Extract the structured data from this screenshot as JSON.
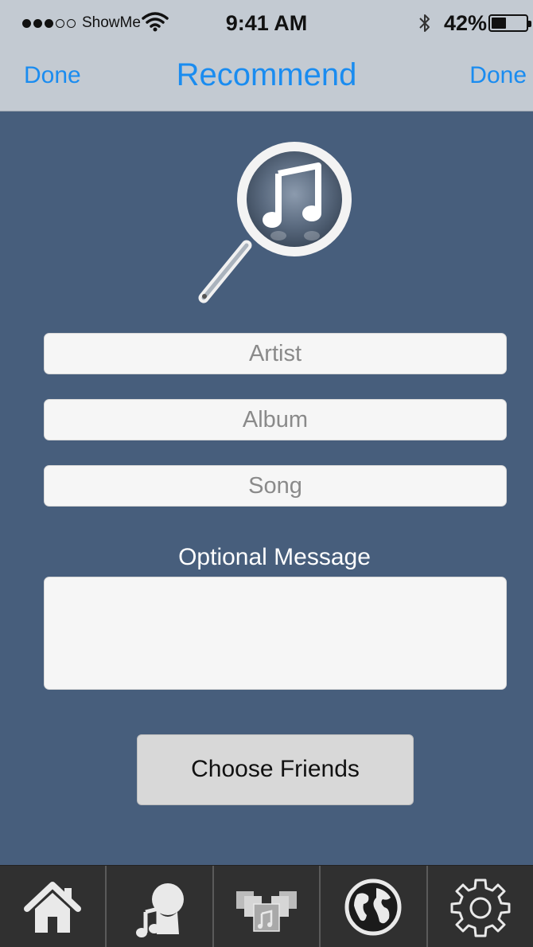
{
  "status_bar": {
    "carrier": "ShowMe",
    "time": "9:41 AM",
    "battery_percent": "42%",
    "battery_level": 0.42
  },
  "nav": {
    "left_button": "Done",
    "title": "Recommend",
    "right_button": "Done"
  },
  "form": {
    "artist_placeholder": "Artist",
    "album_placeholder": "Album",
    "song_placeholder": "Song",
    "message_label": "Optional Message",
    "message_value": "",
    "choose_friends_label": "Choose Friends"
  },
  "tabbar": {
    "items": [
      {
        "icon": "home-icon"
      },
      {
        "icon": "music-person-icon"
      },
      {
        "icon": "albums-icon"
      },
      {
        "icon": "globe-icon"
      },
      {
        "icon": "gear-icon"
      }
    ]
  },
  "colors": {
    "background": "#475e7c",
    "nav_bar": "#c3cad2",
    "accent": "#1a8cf0",
    "tab_bar": "#303030"
  }
}
